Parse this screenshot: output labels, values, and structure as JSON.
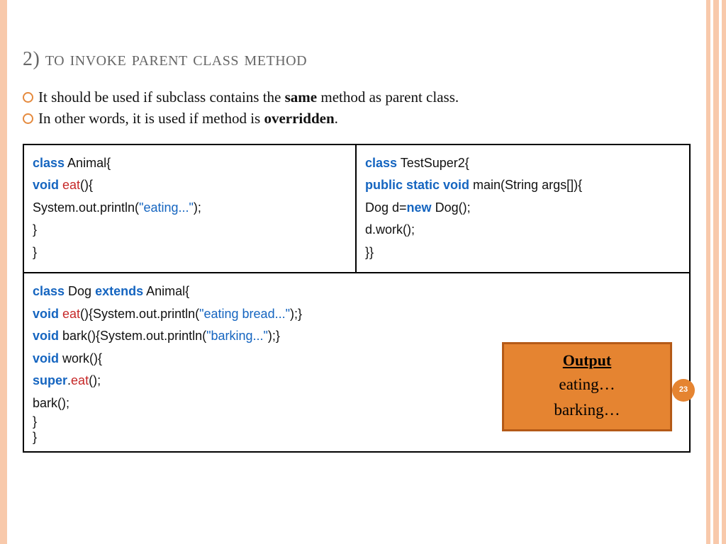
{
  "title_num": "2)",
  "title_rest": " to invoke parent class method",
  "bullets": [
    {
      "pre": "It should be used if subclass contains the ",
      "bold": "same",
      "post": " method as parent class."
    },
    {
      "pre": "In other words, it is used if method is ",
      "bold": "overridden",
      "post": "."
    }
  ],
  "code_left": {
    "l1a": "class",
    "l1b": " Animal{",
    "l2a": "void",
    "l2b": " eat",
    "l2c": "(){",
    "l3a": "System.out.println(",
    "l3b": "\"eating...\"",
    "l3c": ");",
    "l4": "}",
    "l5": "}"
  },
  "code_right": {
    "l1a": "class",
    "l1b": " TestSuper2{",
    "l2a": "public static void",
    "l2b": " main(String args[]){",
    "l3a": "Dog d=",
    "l3b": "new",
    "l3c": " Dog();",
    "l4": "d.work();",
    "l5": "}}"
  },
  "code_wide": {
    "l1a": "class",
    "l1b": " Dog ",
    "l1c": "extends",
    "l1d": " Animal{",
    "l2a": "void",
    "l2b": " eat",
    "l2c": "(){System.out.println(",
    "l2d": "\"eating bread...\"",
    "l2e": ");}",
    "l3a": "void",
    "l3b": " bark(){System.out.println(",
    "l3c": "\"barking...\"",
    "l3d": ");}",
    "l4a": "void",
    "l4b": " work(){",
    "l5a": "super",
    "l5b": ".",
    "l5c": "eat",
    "l5d": "();",
    "l6": "bark();",
    "l7": "}",
    "l8": "}"
  },
  "output": {
    "label": "Output",
    "lines": [
      "eating…",
      "barking…"
    ]
  },
  "page_number": "23"
}
